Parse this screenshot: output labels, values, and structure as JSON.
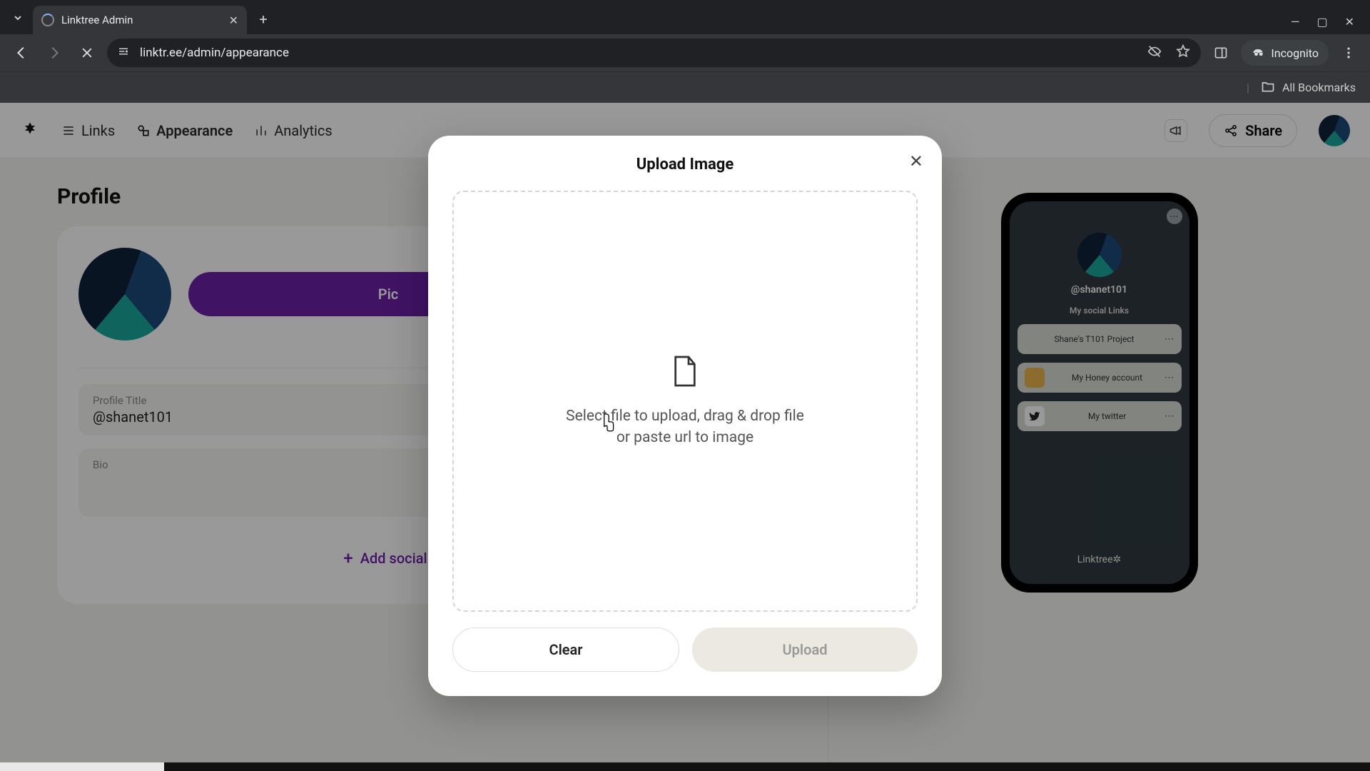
{
  "browser": {
    "tab_title": "Linktree Admin",
    "url": "linktr.ee/admin/appearance",
    "incognito_label": "Incognito",
    "all_bookmarks": "All Bookmarks"
  },
  "nav": {
    "links": "Links",
    "appearance": "Appearance",
    "analytics": "Analytics",
    "share": "Share"
  },
  "profile": {
    "heading": "Profile",
    "pick_image_label": "Pic",
    "title_label": "Profile Title",
    "title_value": "@shanet101",
    "bio_label": "Bio",
    "add_social": "Add social"
  },
  "preview": {
    "handle": "@shanet101",
    "subtitle": "My social Links",
    "links": [
      {
        "label": "Shane's T101 Project"
      },
      {
        "label": "My Honey account"
      },
      {
        "label": "My twitter"
      }
    ],
    "footer": "Linktree"
  },
  "modal": {
    "title": "Upload Image",
    "drop_text_line1": "Select file to upload, drag & drop file",
    "drop_text_line2": "or paste url to image",
    "clear": "Clear",
    "upload": "Upload"
  }
}
